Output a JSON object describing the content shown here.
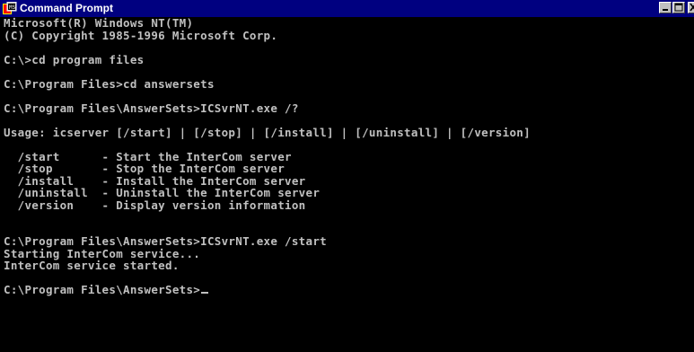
{
  "window": {
    "title": "Command Prompt",
    "icon": "command-prompt-icon",
    "controls": [
      "minimize-icon",
      "maximize-icon",
      "close-icon"
    ],
    "colors": {
      "titlebar": "#000080",
      "console_bg": "#000000",
      "console_text": "#c0c0c0"
    }
  },
  "console": {
    "lines": [
      "Microsoft(R) Windows NT(TM)",
      "(C) Copyright 1985-1996 Microsoft Corp.",
      "",
      "C:\\>cd program files",
      "",
      "C:\\Program Files>cd answersets",
      "",
      "C:\\Program Files\\AnswerSets>ICSvrNT.exe /?",
      "",
      "Usage: icserver [/start] | [/stop] | [/install] | [/uninstall] | [/version]",
      "",
      "  /start      - Start the InterCom server",
      "  /stop       - Stop the InterCom server",
      "  /install    - Install the InterCom server",
      "  /uninstall  - Uninstall the InterCom server",
      "  /version    - Display version information",
      "",
      "",
      "C:\\Program Files\\AnswerSets>ICSvrNT.exe /start",
      "Starting InterCom service...",
      "InterCom service started.",
      "",
      "C:\\Program Files\\AnswerSets>"
    ]
  }
}
